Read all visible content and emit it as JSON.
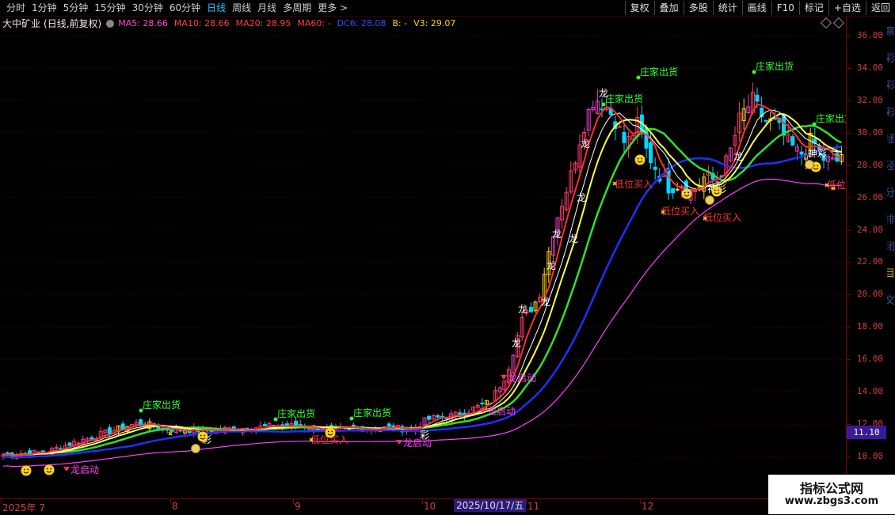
{
  "toolbar": {
    "tabs": [
      "分时",
      "1分钟",
      "5分钟",
      "15分钟",
      "30分钟",
      "60分钟",
      "日线",
      "周线",
      "月线",
      "多周期",
      "更多 >"
    ],
    "active_tab": "日线",
    "right_buttons": [
      "复权",
      "叠加",
      "多股",
      "统计",
      "画线",
      "F10",
      "标记",
      "+自选",
      "返回"
    ]
  },
  "info": {
    "stock": "大中矿业",
    "options": "(日线,前复权)",
    "indicators": [
      {
        "text": "MA5: 28.66",
        "color": "#ff4ad0"
      },
      {
        "text": "MA10: 28.66",
        "color": "#ff4040"
      },
      {
        "text": "MA20: 28.95",
        "color": "#ff4040"
      },
      {
        "text": "MA60: -",
        "color": "#ff4040"
      },
      {
        "text": "DC6: 28.08",
        "color": "#3050ff"
      },
      {
        "text": "B: -",
        "color": "#ffd700"
      },
      {
        "text": "V3: 29.07",
        "color": "#ffd700"
      }
    ]
  },
  "yaxis": [
    "36.00",
    "34.00",
    "32.00",
    "30.00",
    "28.00",
    "26.00",
    "24.00",
    "22.00",
    "20.00",
    "18.00",
    "16.00",
    "14.00",
    "12.00",
    "10.00"
  ],
  "current_price": "11.10",
  "xaxis": {
    "labels": [
      "2025年 7",
      "8",
      "9",
      "10",
      "11",
      "12"
    ],
    "selected_date": "2025/10/17/五"
  },
  "annotations": {
    "sell_label": "庄家出货",
    "buy_label": "低位买入",
    "launch_label": "龙启动",
    "dragon": "龙",
    "cai": "彩",
    "shencai": "神彩"
  },
  "side_panel": [
    "察",
    "彩",
    "彩",
    "彩",
    "拯",
    "泾",
    "分",
    "排",
    "闭",
    "目",
    "文"
  ],
  "watermark": {
    "line1": "指标公式网",
    "line2": "www.zbgs3.com"
  },
  "colors": {
    "up": "#ff3b6b",
    "up_alt": "#e040c0",
    "down": "#00d8ff",
    "gold": "#ffd21a",
    "ma5": "#ffffff",
    "ma10": "#ff3030",
    "ma20": "#ffff40",
    "ma30": "#30e030",
    "ma60": "#2030ff",
    "ma120": "#ff40ff"
  }
}
